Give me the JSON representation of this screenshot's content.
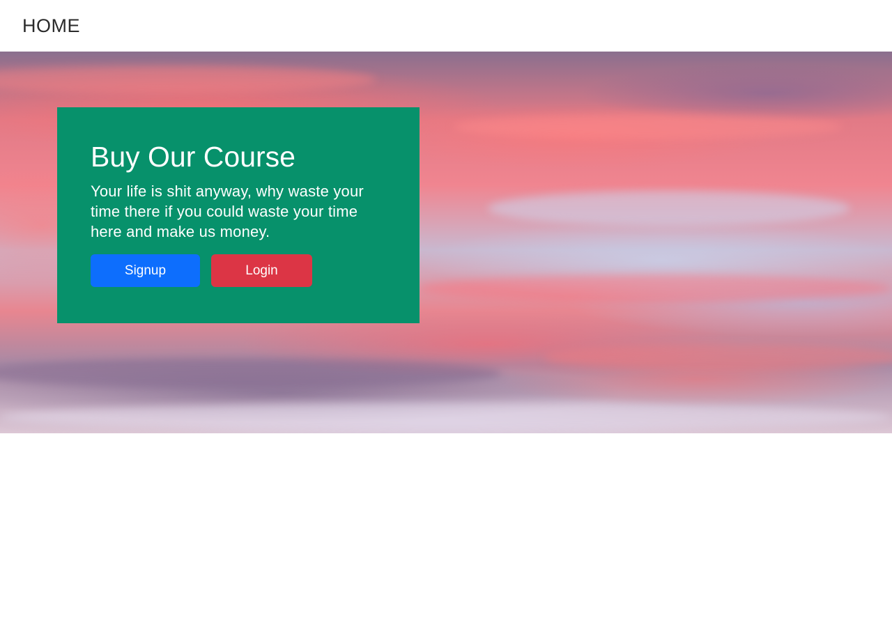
{
  "nav": {
    "home_label": "HOME"
  },
  "hero": {
    "title": "Buy Our Course",
    "description": "Your life is shit anyway, why waste your time there if you could waste your time here and make us money.",
    "signup_label": "Signup",
    "login_label": "Login"
  },
  "colors": {
    "card_background": "#07916b",
    "signup_button": "#0d6efd",
    "login_button": "#dc3545"
  },
  "images": {
    "hero_background": "sunset-sky-with-pink-clouds"
  }
}
